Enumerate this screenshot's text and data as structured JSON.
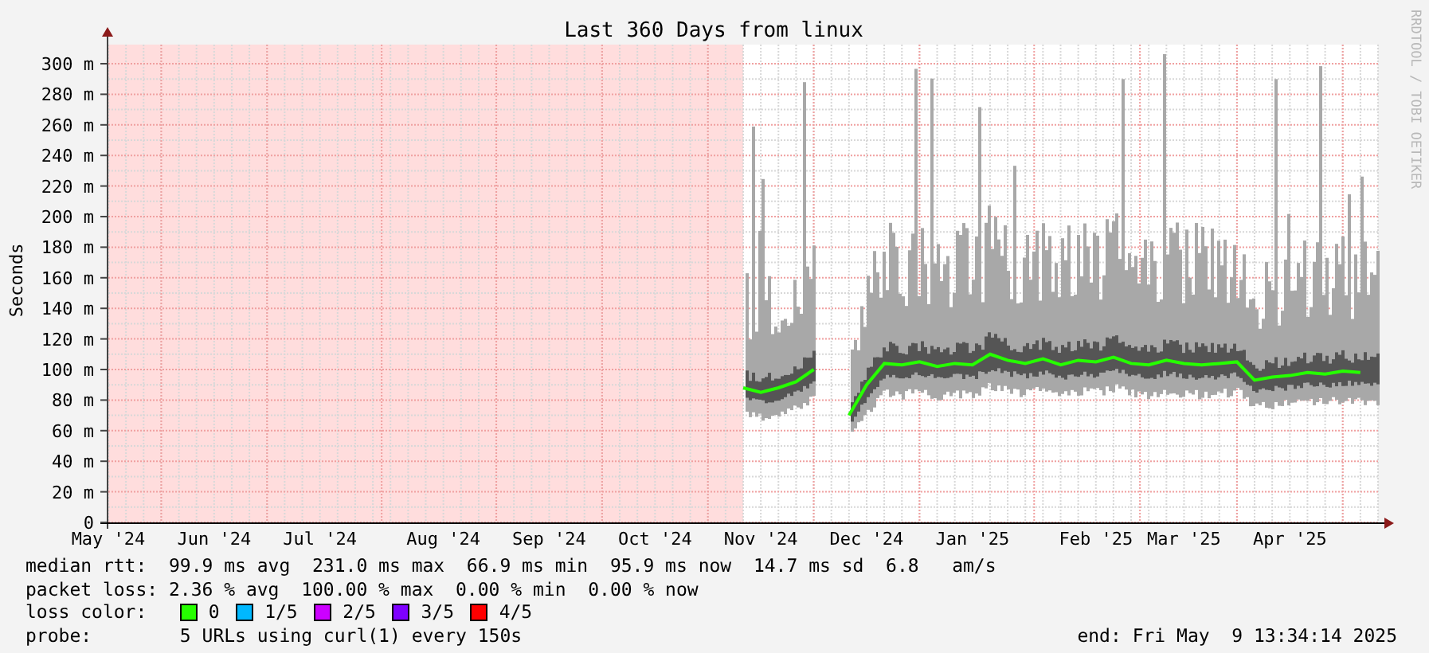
{
  "graph": {
    "credit": "RRDTOOL / TOBI OETIKER",
    "chart_data": {
      "type": "line",
      "title": "Last 360 Days from linux",
      "ylabel": "Seconds",
      "ylim": [
        0,
        312.5
      ],
      "grid": true,
      "yticks": [
        {
          "value": 0,
          "label": "0"
        },
        {
          "value": 20,
          "label": "20 m"
        },
        {
          "value": 40,
          "label": "40 m"
        },
        {
          "value": 60,
          "label": "60 m"
        },
        {
          "value": 80,
          "label": "80 m"
        },
        {
          "value": 100,
          "label": "100 m"
        },
        {
          "value": 120,
          "label": "120 m"
        },
        {
          "value": 140,
          "label": "140 m"
        },
        {
          "value": 160,
          "label": "160 m"
        },
        {
          "value": 180,
          "label": "180 m"
        },
        {
          "value": 200,
          "label": "200 m"
        },
        {
          "value": 220,
          "label": "220 m"
        },
        {
          "value": 240,
          "label": "240 m"
        },
        {
          "value": 260,
          "label": "260 m"
        },
        {
          "value": 280,
          "label": "280 m"
        },
        {
          "value": 300,
          "label": "300 m"
        }
      ],
      "categories": [
        "May '24",
        null,
        null,
        null,
        null,
        null,
        "Jun '24",
        null,
        null,
        null,
        null,
        null,
        "Jul '24",
        null,
        null,
        null,
        null,
        null,
        null,
        "Aug '24",
        null,
        null,
        null,
        null,
        null,
        "Sep '24",
        null,
        null,
        null,
        null,
        null,
        "Oct '24",
        null,
        null,
        null,
        null,
        null,
        "Nov '24",
        null,
        null,
        null,
        null,
        null,
        "Dec '24",
        null,
        null,
        null,
        null,
        null,
        "Jan '25",
        null,
        null,
        null,
        null,
        null,
        null,
        "Feb '25",
        null,
        null,
        null,
        null,
        "Mar '25",
        null,
        null,
        null,
        null,
        null,
        "Apr '25",
        null,
        null,
        null,
        null
      ],
      "series": [
        {
          "color": "#26ff00",
          "values": [
            null,
            null,
            null,
            null,
            null,
            null,
            null,
            null,
            null,
            null,
            null,
            null,
            null,
            null,
            null,
            null,
            null,
            null,
            null,
            null,
            null,
            null,
            null,
            null,
            null,
            null,
            null,
            null,
            null,
            null,
            null,
            null,
            null,
            null,
            null,
            null,
            88,
            85,
            88,
            92,
            100,
            null,
            70,
            90,
            104,
            103,
            105,
            102,
            104,
            103,
            110,
            106,
            104,
            107,
            103,
            106,
            105,
            108,
            104,
            103,
            106,
            104,
            103,
            104,
            105,
            93,
            95,
            96,
            98,
            97,
            99,
            98
          ]
        }
      ]
    }
  },
  "legend": [
    {
      "kind": "text",
      "label": "median rtt:",
      "value": "99.9 ms avg  231.0 ms max  66.9 ms min  95.9 ms now  14.7 ms sd  6.8   am/s"
    },
    {
      "kind": "text",
      "label": "packet loss:",
      "value": "2.36 % avg  100.00 % max  0.00 % min  0.00 % now"
    },
    {
      "kind": "swatches",
      "label": "loss color:",
      "items": [
        {
          "label": "0",
          "color": "#26ff00"
        },
        {
          "label": "1/5",
          "color": "#00b8ff"
        },
        {
          "label": "2/5",
          "color": "#cc00ff"
        },
        {
          "label": "3/5",
          "color": "#7e00ff"
        },
        {
          "label": "4/5",
          "color": "#ff0000"
        }
      ]
    },
    {
      "kind": "probe",
      "label": "probe:",
      "value": "5 URLs using curl(1) every 150s",
      "end": "end: Fri May  9 13:34:14 2025"
    }
  ]
}
